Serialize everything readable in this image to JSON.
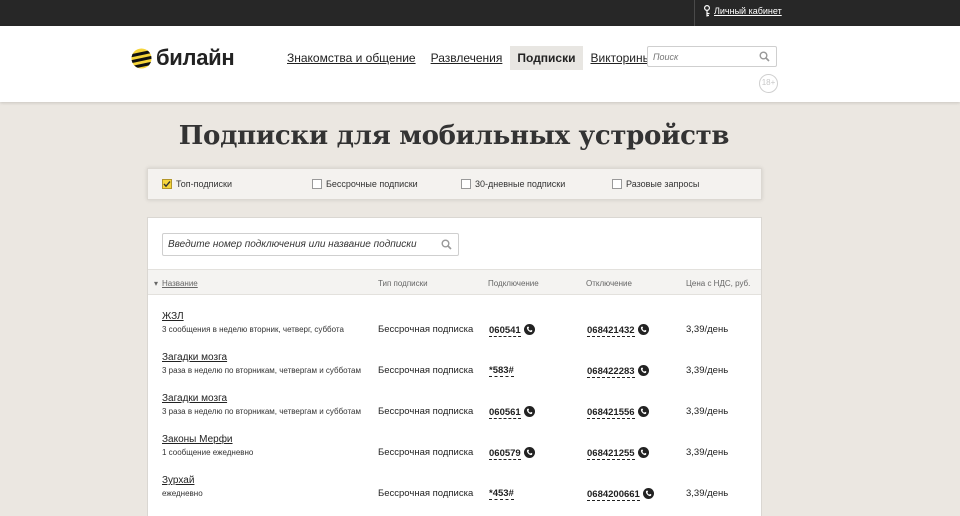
{
  "topbar": {
    "cabinet_label": "Личный кабинет"
  },
  "header": {
    "logo_text": "билайн",
    "nav": [
      {
        "label": "Знакомства и общение",
        "active": false
      },
      {
        "label": "Развлечения",
        "active": false
      },
      {
        "label": "Подписки",
        "active": true
      },
      {
        "label": "Викторины",
        "active": false
      }
    ],
    "search_placeholder": "Поиск",
    "age_badge": "18+"
  },
  "page": {
    "title": "Подписки для мобильных устройств"
  },
  "filters": [
    {
      "label": "Топ-подписки",
      "checked": true
    },
    {
      "label": "Бессрочные подписки",
      "checked": false
    },
    {
      "label": "30-дневные подписки",
      "checked": false
    },
    {
      "label": "Разовые запросы",
      "checked": false
    }
  ],
  "table": {
    "search_placeholder": "Введите номер подключения или название подписки",
    "columns": {
      "name": "Название",
      "type": "Тип подписки",
      "connect": "Подключение",
      "disconnect": "Отключение",
      "price": "Цена с НДС, руб."
    },
    "rows": [
      {
        "name": "ЖЗЛ",
        "desc": "3 сообщения в неделю вторник, четверг, суббота",
        "type": "Бессрочная подписка",
        "connect": "060541",
        "connect_phone": true,
        "disconnect": "068421432",
        "price": "3,39/день"
      },
      {
        "name": "Загадки мозга",
        "desc": "3 раза в неделю по вторникам, четвергам и субботам",
        "type": "Бессрочная подписка",
        "connect": "*583#",
        "connect_phone": false,
        "disconnect": "068422283",
        "price": "3,39/день"
      },
      {
        "name": "Загадки мозга",
        "desc": "3 раза в неделю по вторникам, четвергам и субботам",
        "type": "Бессрочная подписка",
        "connect": "060561",
        "connect_phone": true,
        "disconnect": "068421556",
        "price": "3,39/день"
      },
      {
        "name": "Законы Мерфи",
        "desc": "1 сообщение ежедневно",
        "type": "Бессрочная подписка",
        "connect": "060579",
        "connect_phone": true,
        "disconnect": "068421255",
        "price": "3,39/день"
      },
      {
        "name": "Зурхай",
        "desc": "ежедневно",
        "type": "Бессрочная подписка",
        "connect": "*453#",
        "connect_phone": false,
        "disconnect": "0684200661",
        "price": "3,39/день"
      }
    ]
  },
  "colors": {
    "brand_yellow": "#f6d53a",
    "topbar": "#272727",
    "page_bg": "#ebe7e1"
  }
}
